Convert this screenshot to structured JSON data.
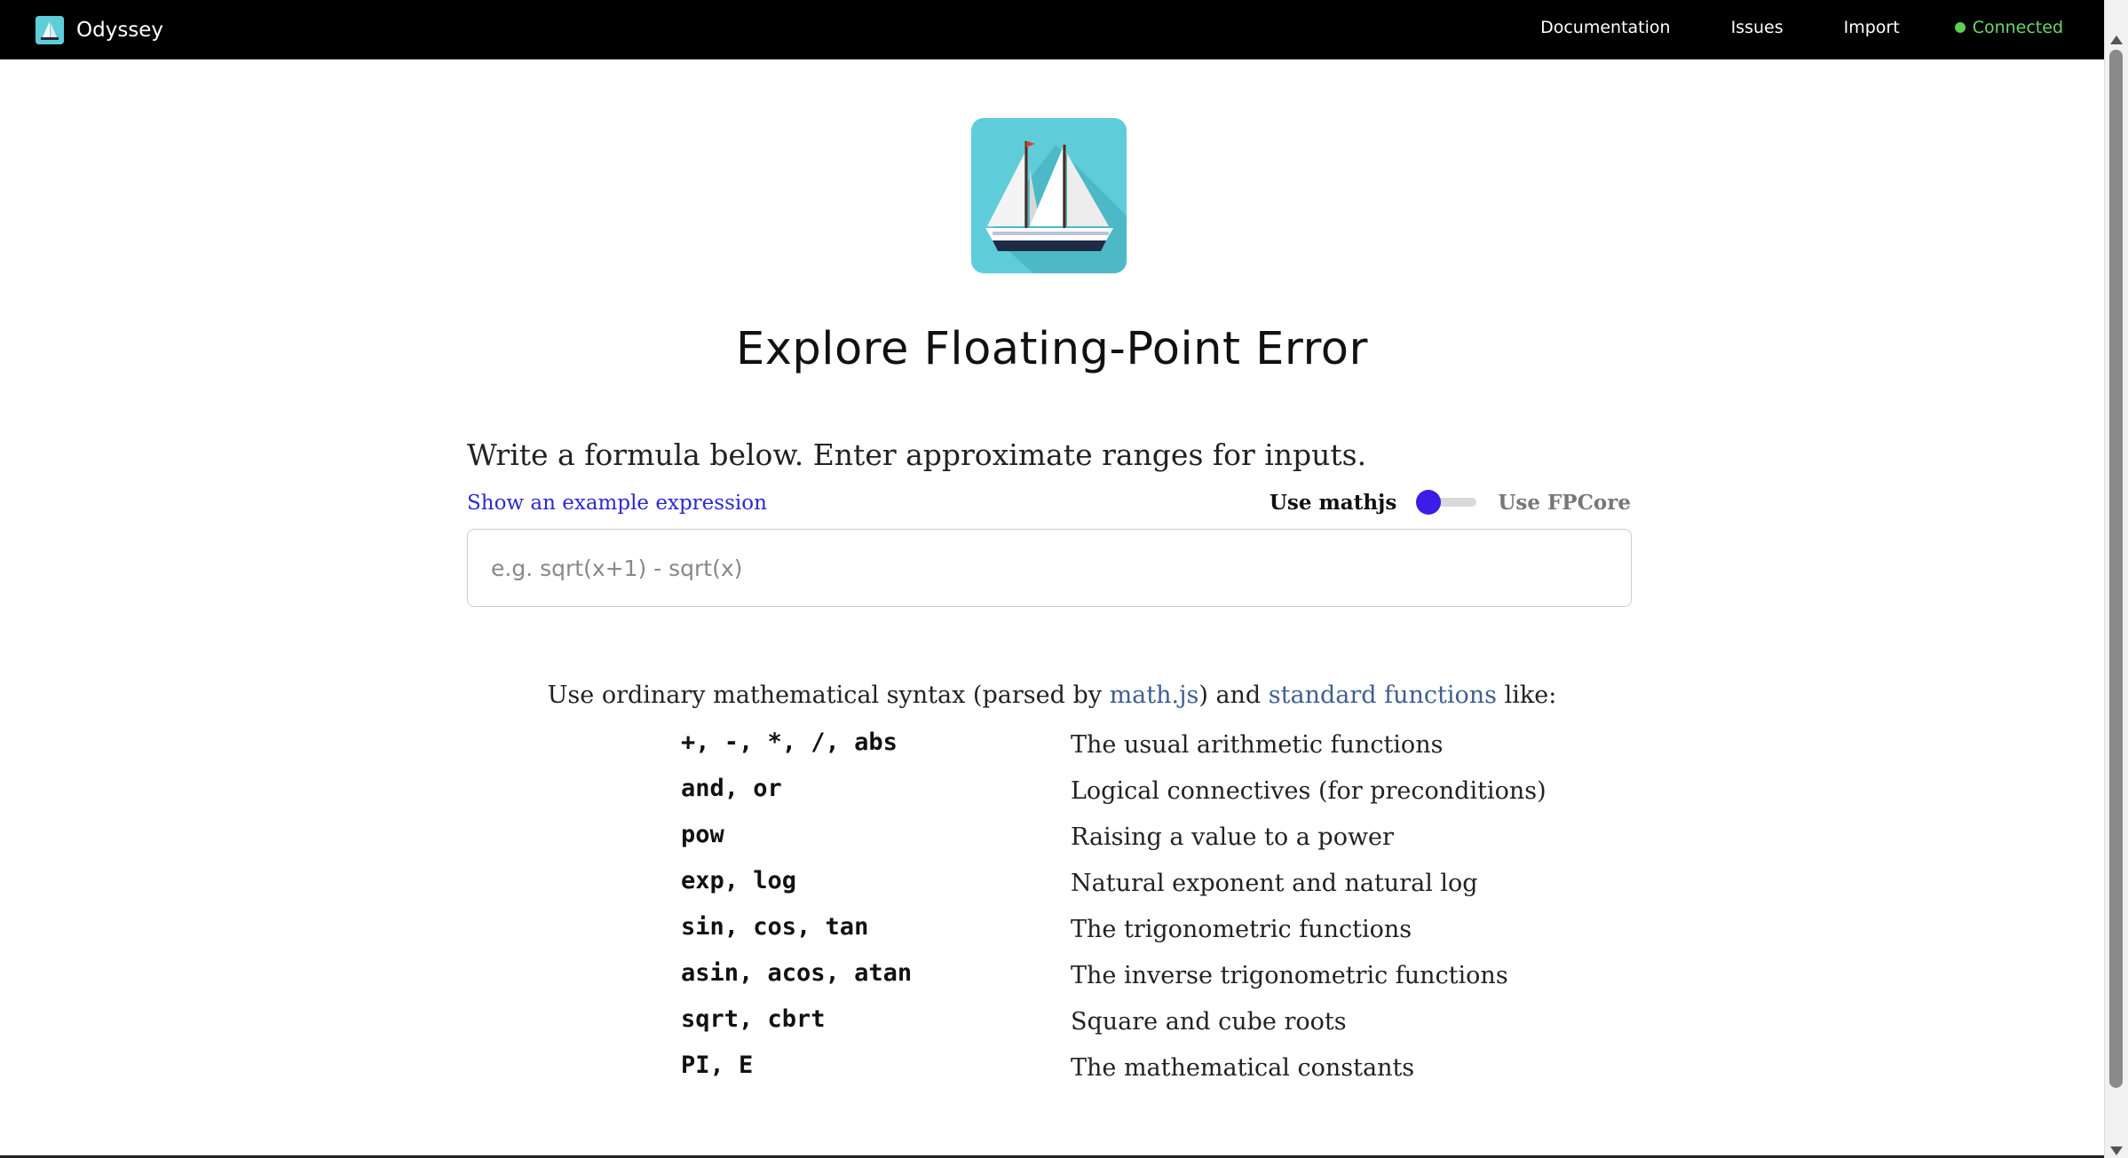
{
  "header": {
    "brand_name": "Odyssey",
    "links": [
      "Documentation",
      "Issues",
      "Import"
    ],
    "status": "Connected",
    "status_color": "#5ccf55"
  },
  "main": {
    "title": "Explore Floating-Point Error",
    "intro": "Write a formula below. Enter approximate ranges for inputs.",
    "example_link": "Show an example expression",
    "mode_left": "Use mathjs",
    "mode_right": "Use FPCore",
    "formula_placeholder": "e.g. sqrt(x+1) - sqrt(x)",
    "formula_value": "",
    "syntax_prefix": "Use ordinary mathematical syntax (parsed by ",
    "syntax_link1": "math.js",
    "syntax_middle": ") and ",
    "syntax_link2": "standard functions",
    "syntax_suffix": " like:",
    "functions": [
      {
        "code": "+, -, *, /, abs",
        "desc": "The usual arithmetic functions"
      },
      {
        "code": "and, or",
        "desc": "Logical connectives (for preconditions)"
      },
      {
        "code": "pow",
        "desc": "Raising a value to a power"
      },
      {
        "code": "exp, log",
        "desc": "Natural exponent and natural log"
      },
      {
        "code": "sin, cos, tan",
        "desc": "The trigonometric functions"
      },
      {
        "code": "asin, acos, atan",
        "desc": "The inverse trigonometric functions"
      },
      {
        "code": "sqrt, cbrt",
        "desc": "Square and cube roots"
      },
      {
        "code": "PI, E",
        "desc": "The mathematical constants"
      }
    ]
  },
  "colors": {
    "accent": "#3a1de6",
    "link": "#2a2ad1",
    "logo_bg": "#5fcdd9"
  }
}
